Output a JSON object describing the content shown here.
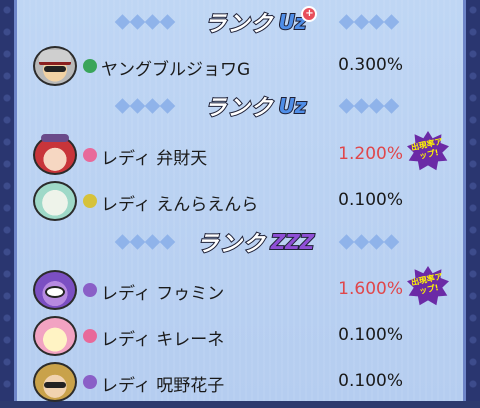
{
  "sections": [
    {
      "rank_label": "ランク",
      "rank_badge": "Uz",
      "rank_plus": "+",
      "rows": [
        {
          "name": "ヤングブルジョワG",
          "rate": "0.300%",
          "attr_icon": "clover-icon",
          "attr_color": "#3aa55a",
          "highlight": false
        }
      ]
    },
    {
      "rank_label": "ランク",
      "rank_badge": "Uz",
      "rows": [
        {
          "name": "レディ 弁財天",
          "rate": "1.200%",
          "attr_icon": "heart-icon",
          "attr_color": "#e8699a",
          "highlight": true,
          "badge": "出現率\nアップ!"
        },
        {
          "name": "レディ えんらえんら",
          "rate": "0.100%",
          "attr_icon": "bulb-icon",
          "attr_color": "#d6c23a",
          "highlight": false
        }
      ]
    },
    {
      "rank_label": "ランク",
      "rank_badge": "ZZZ",
      "rows": [
        {
          "name": "レディ フゥミン",
          "rate": "1.600%",
          "attr_icon": "eye-icon",
          "attr_color": "#8a5fc7",
          "highlight": true,
          "badge": "出現率\nアップ!"
        },
        {
          "name": "レディ キレーネ",
          "rate": "0.100%",
          "attr_icon": "heart-icon",
          "attr_color": "#e8699a",
          "highlight": false
        },
        {
          "name": "レディ 呪野花子",
          "rate": "0.100%",
          "attr_icon": "eye-icon",
          "attr_color": "#8a5fc7",
          "highlight": false
        }
      ]
    }
  ],
  "badge_text": "出現率アップ!",
  "colors": {
    "rate_up": "#e0474b",
    "rate_normal": "#1a1a1a",
    "panel": "#bfd6f4"
  }
}
